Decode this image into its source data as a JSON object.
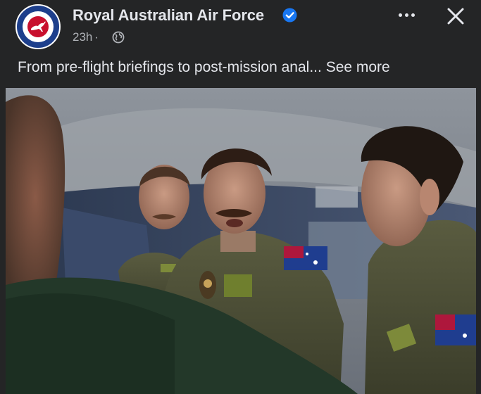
{
  "post": {
    "page_name": "Royal Australian Air Force",
    "time": "23h",
    "separator": "·",
    "caption_text": "From pre-flight briefings to post-mission anal...",
    "see_more_label": "See more"
  },
  "icons": {
    "avatar": "raaf-roundel-avatar",
    "verified": "verified-badge-icon",
    "audience": "globe-icon",
    "more": "more-options-icon",
    "close": "close-icon"
  },
  "colors": {
    "background": "#242526",
    "primary_text": "#e4e6eb",
    "secondary_text": "#b0b3b8",
    "verified_blue": "#1877f2"
  }
}
